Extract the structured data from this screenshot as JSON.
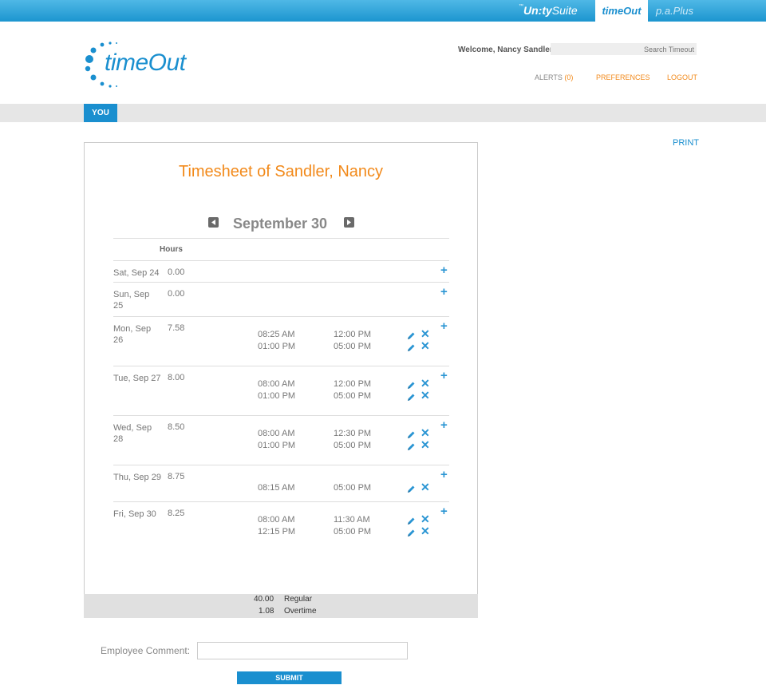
{
  "suite": {
    "logo_prefix": "™",
    "logo_bold": "Un:ty",
    "logo_rest": "Suite",
    "active_app": "timeOut",
    "other_app": "p.a.Plus"
  },
  "header": {
    "logo_text": "timeOut",
    "welcome": "Welcome, Nancy Sandler",
    "search_placeholder": "Search Timeout",
    "alerts_label": "ALERTS",
    "alerts_count": "(0)",
    "preferences": "PREFERENCES",
    "logout": "LOGOUT"
  },
  "tabs": {
    "you": "YOU"
  },
  "print": "PRINT",
  "timesheet": {
    "title": "Timesheet of Sandler, Nancy",
    "week": "September 30",
    "hours_header": "Hours",
    "days": [
      {
        "day": "Sat, Sep 24",
        "hours": "0.00",
        "entries": []
      },
      {
        "day": "Sun, Sep 25",
        "hours": "0.00",
        "entries": []
      },
      {
        "day": "Mon, Sep 26",
        "hours": "7.58",
        "entries": [
          {
            "in": "08:25 AM",
            "out": "12:00 PM"
          },
          {
            "in": "01:00 PM",
            "out": "05:00 PM"
          }
        ]
      },
      {
        "day": "Tue, Sep 27",
        "hours": "8.00",
        "entries": [
          {
            "in": "08:00 AM",
            "out": "12:00 PM"
          },
          {
            "in": "01:00 PM",
            "out": "05:00 PM"
          }
        ]
      },
      {
        "day": "Wed, Sep 28",
        "hours": "8.50",
        "entries": [
          {
            "in": "08:00 AM",
            "out": "12:30 PM"
          },
          {
            "in": "01:00 PM",
            "out": "05:00 PM"
          }
        ]
      },
      {
        "day": "Thu, Sep 29",
        "hours": "8.75",
        "entries": [
          {
            "in": "08:15 AM",
            "out": "05:00 PM"
          }
        ]
      },
      {
        "day": "Fri, Sep 30",
        "hours": "8.25",
        "entries": [
          {
            "in": "08:00 AM",
            "out": "11:30 AM"
          },
          {
            "in": "12:15 PM",
            "out": "05:00 PM"
          }
        ]
      }
    ]
  },
  "summary": {
    "regular_value": "40.00",
    "regular_label": "Regular",
    "overtime_value": "1.08",
    "overtime_label": "Overtime"
  },
  "comment": {
    "label": "Employee Comment:",
    "value": ""
  },
  "submit_label": "SUBMIT",
  "colors": {
    "accent_blue": "#1a8fcf",
    "accent_orange": "#f28a1b"
  }
}
